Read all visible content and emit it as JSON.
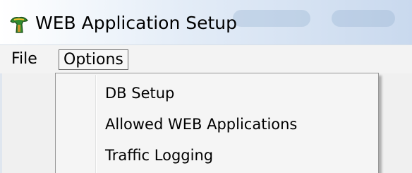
{
  "window": {
    "title": "WEB Application Setup",
    "icon": "app-logo-icon"
  },
  "menubar": {
    "items": [
      {
        "label": "File"
      },
      {
        "label": "Options"
      }
    ]
  },
  "options_menu": {
    "items": [
      {
        "label": "DB Setup"
      },
      {
        "label": "Allowed WEB Applications"
      },
      {
        "label": "Traffic Logging"
      }
    ]
  }
}
